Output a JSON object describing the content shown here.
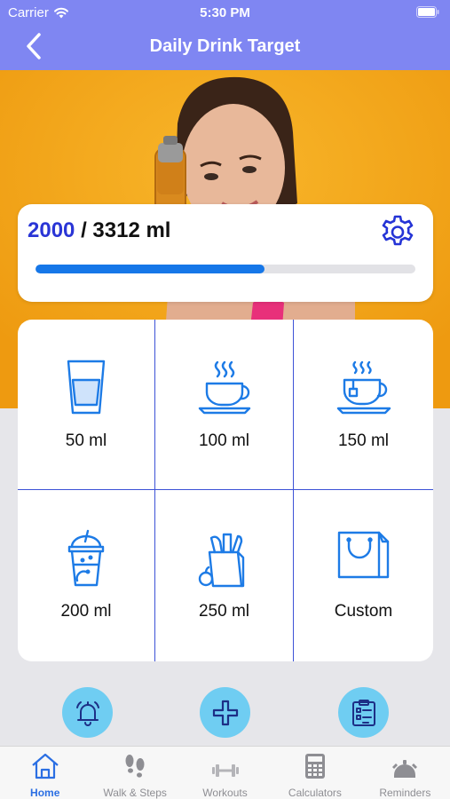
{
  "status_bar": {
    "carrier": "Carrier",
    "time": "5:30 PM"
  },
  "nav": {
    "title": "Daily Drink Target",
    "back_icon": "chevron-left-icon"
  },
  "progress": {
    "current": "2000",
    "separator": "/",
    "target": "3312 ml",
    "fraction": 0.6039
  },
  "drinks": [
    {
      "label": "50 ml",
      "icon": "glass-icon"
    },
    {
      "label": "100 ml",
      "icon": "coffee-cup-icon"
    },
    {
      "label": "150 ml",
      "icon": "tea-cup-icon"
    },
    {
      "label": "200 ml",
      "icon": "smoothie-cup-icon"
    },
    {
      "label": "250 ml",
      "icon": "grocery-bag-icon"
    },
    {
      "label": "Custom",
      "icon": "shopping-bag-icon"
    }
  ],
  "actions": [
    {
      "icon": "bell-icon"
    },
    {
      "icon": "plus-icon"
    },
    {
      "icon": "clipboard-icon"
    }
  ],
  "tabs": [
    {
      "label": "Home",
      "icon": "home-icon",
      "active": true
    },
    {
      "label": "Walk & Steps",
      "icon": "footsteps-icon",
      "active": false
    },
    {
      "label": "Workouts",
      "icon": "dumbbell-icon",
      "active": false
    },
    {
      "label": "Calculators",
      "icon": "calculator-icon",
      "active": false
    },
    {
      "label": "Reminders",
      "icon": "alarm-icon",
      "active": false
    }
  ],
  "colors": {
    "accent": "#7f86f2",
    "progress": "#1677e8",
    "icon_blue": "#1d7be6",
    "fab": "#6fcdf2",
    "hero": "#f3a517"
  }
}
